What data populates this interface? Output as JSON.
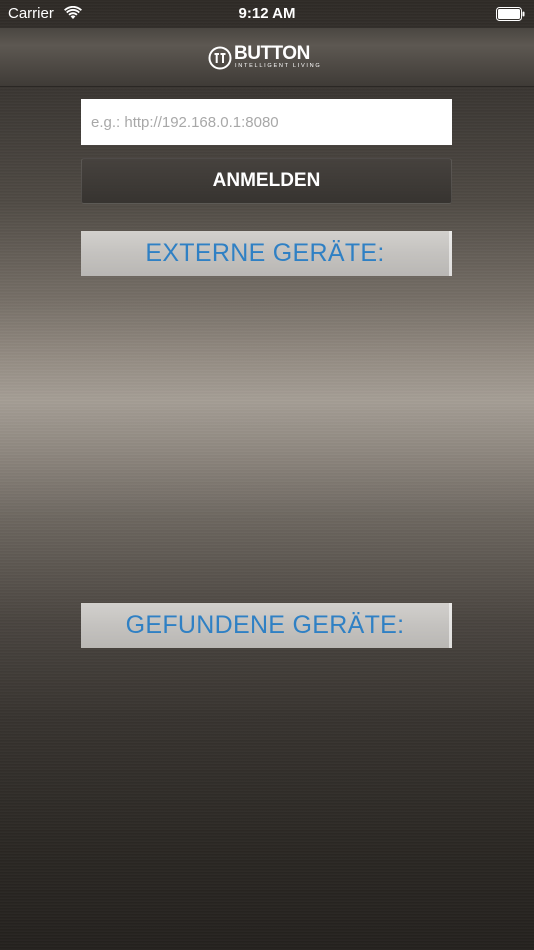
{
  "status_bar": {
    "carrier": "Carrier",
    "time": "9:12 AM"
  },
  "header": {
    "logo_word": "BUTTON",
    "logo_tagline": "INTELLIGENT LIVING"
  },
  "login": {
    "url_placeholder": "e.g.: http://192.168.0.1:8080",
    "url_value": "",
    "button_label": "ANMELDEN"
  },
  "sections": {
    "external_title": "EXTERNE GERÄTE:",
    "found_title": "GEFUNDENE GERÄTE:"
  },
  "colors": {
    "accent": "#2f80c4",
    "header_bg": "#c4c2bf",
    "input_bg": "#ffffff"
  }
}
